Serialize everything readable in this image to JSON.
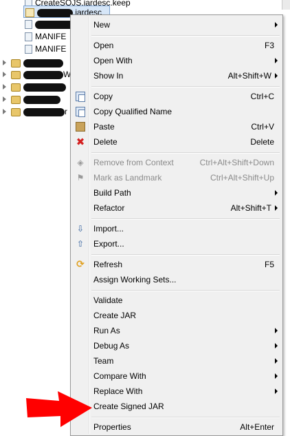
{
  "tree": {
    "rows": [
      {
        "label": "CreateSOJS.jardesc.keep",
        "icon": "file-icon"
      },
      {
        "label": ".jardesc",
        "icon": "jar-icon",
        "selected": true
      },
      {
        "label": "CopyDesc",
        "icon": "file-icon"
      },
      {
        "label": "MANIFE",
        "icon": "file-icon"
      },
      {
        "label": "MANIFE",
        "icon": "file-icon"
      }
    ],
    "projects": [
      {
        "label": "",
        "icon": "project-icon"
      },
      {
        "label": "W",
        "icon": "project-icon"
      },
      {
        "label": "",
        "icon": "project-icon"
      },
      {
        "label": "",
        "icon": "project-icon"
      },
      {
        "label": "r",
        "icon": "project-icon"
      }
    ]
  },
  "menu": {
    "items": [
      {
        "label": "New",
        "shortcut": "",
        "submenu": true,
        "icon": ""
      },
      {
        "label": "Open",
        "shortcut": "F3",
        "submenu": false,
        "icon": ""
      },
      {
        "label": "Open With",
        "shortcut": "",
        "submenu": true,
        "icon": ""
      },
      {
        "label": "Show In",
        "shortcut": "Alt+Shift+W",
        "submenu": true,
        "icon": ""
      },
      {
        "label": "Copy",
        "shortcut": "Ctrl+C",
        "submenu": false,
        "icon": "copy-icon"
      },
      {
        "label": "Copy Qualified Name",
        "shortcut": "",
        "submenu": false,
        "icon": "copy-icon"
      },
      {
        "label": "Paste",
        "shortcut": "Ctrl+V",
        "submenu": false,
        "icon": "paste-icon"
      },
      {
        "label": "Delete",
        "shortcut": "Delete",
        "submenu": false,
        "icon": "delete-icon"
      },
      {
        "label": "Remove from Context",
        "shortcut": "Ctrl+Alt+Shift+Down",
        "submenu": false,
        "disabled": true,
        "icon": "remove-context-icon"
      },
      {
        "label": "Mark as Landmark",
        "shortcut": "Ctrl+Alt+Shift+Up",
        "submenu": false,
        "disabled": true,
        "icon": "landmark-icon"
      },
      {
        "label": "Build Path",
        "shortcut": "",
        "submenu": true,
        "icon": ""
      },
      {
        "label": "Refactor",
        "shortcut": "Alt+Shift+T",
        "submenu": true,
        "icon": ""
      },
      {
        "label": "Import...",
        "shortcut": "",
        "submenu": false,
        "icon": "import-icon"
      },
      {
        "label": "Export...",
        "shortcut": "",
        "submenu": false,
        "icon": "export-icon"
      },
      {
        "label": "Refresh",
        "shortcut": "F5",
        "submenu": false,
        "icon": "refresh-icon"
      },
      {
        "label": "Assign Working Sets...",
        "shortcut": "",
        "submenu": false,
        "icon": ""
      },
      {
        "label": "Validate",
        "shortcut": "",
        "submenu": false,
        "icon": ""
      },
      {
        "label": "Create JAR",
        "shortcut": "",
        "submenu": false,
        "icon": ""
      },
      {
        "label": "Run As",
        "shortcut": "",
        "submenu": true,
        "icon": ""
      },
      {
        "label": "Debug As",
        "shortcut": "",
        "submenu": true,
        "icon": ""
      },
      {
        "label": "Team",
        "shortcut": "",
        "submenu": true,
        "icon": ""
      },
      {
        "label": "Compare With",
        "shortcut": "",
        "submenu": true,
        "icon": ""
      },
      {
        "label": "Replace With",
        "shortcut": "",
        "submenu": true,
        "icon": ""
      },
      {
        "label": "Create Signed JAR",
        "shortcut": "",
        "submenu": false,
        "icon": ""
      },
      {
        "label": "Properties",
        "shortcut": "Alt+Enter",
        "submenu": false,
        "icon": ""
      }
    ]
  },
  "colors": {
    "menu_background": "#f0f0f0",
    "disabled_text": "#8a8a8a",
    "annotation_arrow": "#ff0000"
  }
}
